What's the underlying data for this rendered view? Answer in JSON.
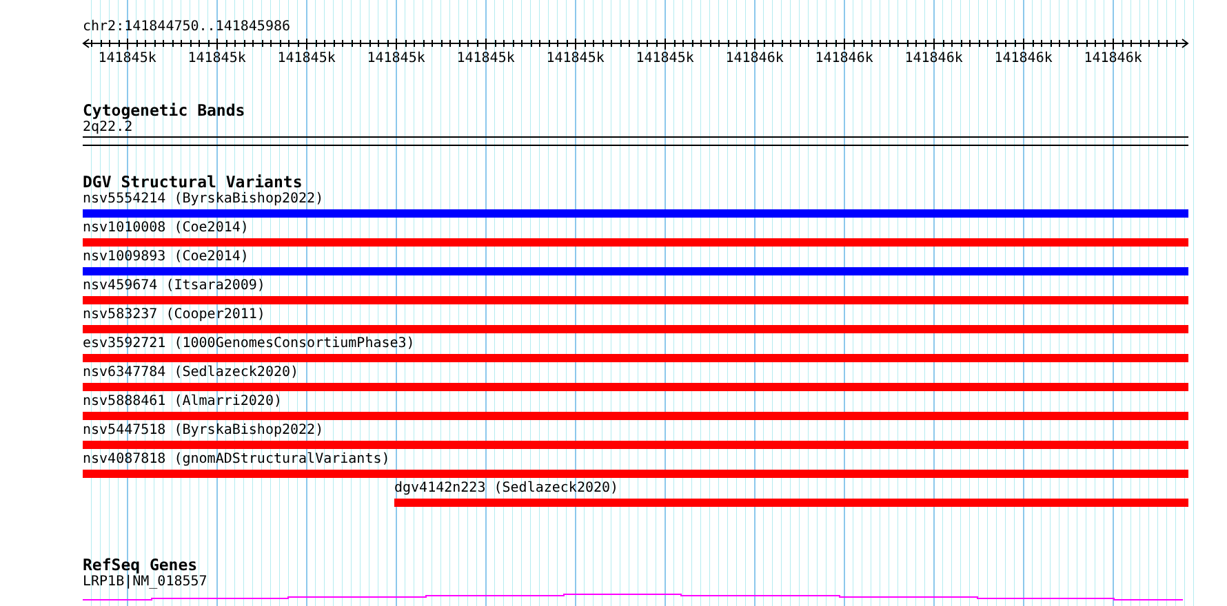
{
  "location": "chr2:141844750..141845986",
  "ruler": {
    "labels": [
      "141845k",
      "141845k",
      "141845k",
      "141845k",
      "141845k",
      "141845k",
      "141845k",
      "141846k",
      "141846k",
      "141846k",
      "141846k",
      "141846k"
    ]
  },
  "tracks": [
    {
      "kind": "cytoband",
      "title": "Cytogenetic Bands",
      "band": "2q22.2"
    },
    {
      "kind": "variants",
      "title": "DGV Structural Variants",
      "features": [
        {
          "label": "nsv5554214 (ByrskaBishop2022)",
          "color": "#0000ff",
          "kind": "spanning"
        },
        {
          "label": "nsv1010008 (Coe2014)",
          "color": "#ff0000",
          "kind": "spanning"
        },
        {
          "label": "nsv1009893 (Coe2014)",
          "color": "#0000ff",
          "kind": "spanning"
        },
        {
          "label": "nsv459674 (Itsara2009)",
          "color": "#ff0000",
          "kind": "spanning"
        },
        {
          "label": "nsv583237 (Cooper2011)",
          "color": "#ff0000",
          "kind": "spanning"
        },
        {
          "label": "esv3592721 (1000GenomesConsortiumPhase3)",
          "color": "#ff0000",
          "kind": "spanning"
        },
        {
          "label": "nsv6347784 (Sedlazeck2020)",
          "color": "#ff0000",
          "kind": "spanning"
        },
        {
          "label": "nsv5888461 (Almarri2020)",
          "color": "#ff0000",
          "kind": "spanning"
        },
        {
          "label": "nsv5447518 (ByrskaBishop2022)",
          "color": "#ff0000",
          "kind": "spanning"
        },
        {
          "label": "nsv4087818 (gnomADStructuralVariants)",
          "color": "#ff0000",
          "kind": "spanning"
        },
        {
          "label": "dgv4142n223 (Sedlazeck2020)",
          "color": "#ff0000",
          "kind": "partial"
        }
      ]
    },
    {
      "kind": "gene",
      "title": "RefSeq Genes",
      "gene": "LRP1B|NM_018557"
    }
  ]
}
